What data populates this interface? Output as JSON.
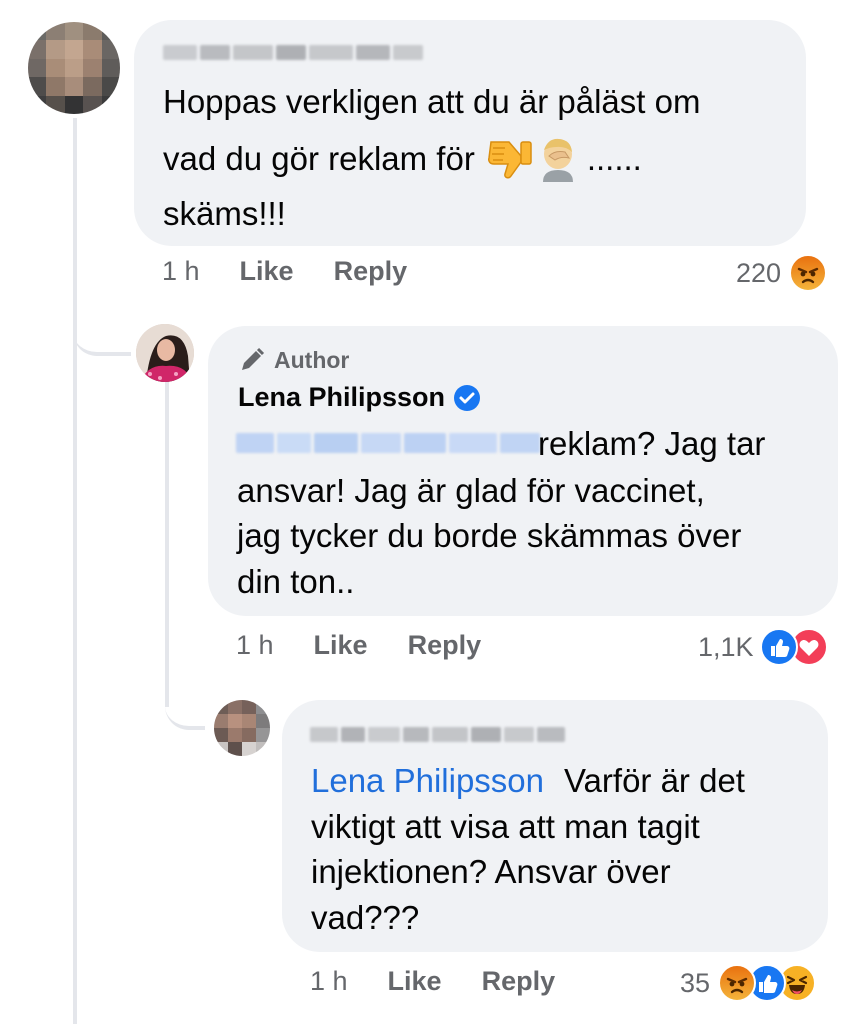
{
  "comments": [
    {
      "author_redacted": true,
      "text": "Hoppas verkligen att du är påläst om vad du gör reklam för 👎🤦🏼......  skäms!!!",
      "line1": "Hoppas verkligen att du är påläst om",
      "line2_text": "vad du gör reklam för",
      "line2_tail": "......",
      "line3": "skäms!!!",
      "time": "1 h",
      "like_label": "Like",
      "reply_label": "Reply",
      "reaction_count": "220",
      "reactions": [
        "angry"
      ]
    },
    {
      "author_badge": "Author",
      "author_name": "Lena Philipsson",
      "verified": true,
      "line1_tail": "reklam? Jag tar",
      "line2": "ansvar! Jag är glad för vaccinet,",
      "line3": "jag tycker du borde skämmas över",
      "line4": "din ton..",
      "time": "1 h",
      "like_label": "Like",
      "reply_label": "Reply",
      "reaction_count": "1,1K",
      "reactions": [
        "like",
        "love"
      ]
    },
    {
      "author_redacted": true,
      "mention": "Lena Philipsson",
      "line1_tail": "Varför är det",
      "line2": "viktigt att visa att man tagit",
      "line3": "injektionen? Ansvar över",
      "line4": "vad???",
      "time": "1 h",
      "like_label": "Like",
      "reply_label": "Reply",
      "reaction_count": "35",
      "reactions": [
        "angry",
        "like",
        "haha"
      ]
    }
  ],
  "colors": {
    "bubble": "#f0f2f5",
    "meta_text": "#65676b",
    "mention": "#216fdb",
    "like_blue": "#1877f2",
    "love_red": "#f33e58",
    "angry_orange": "#e9710f",
    "haha_yellow": "#f7b125"
  },
  "icons": [
    "thumbs-down-emoji",
    "face-palm-emoji",
    "pen-icon",
    "verified-badge-icon",
    "angry-reaction-icon",
    "like-reaction-icon",
    "love-reaction-icon",
    "haha-reaction-icon"
  ]
}
